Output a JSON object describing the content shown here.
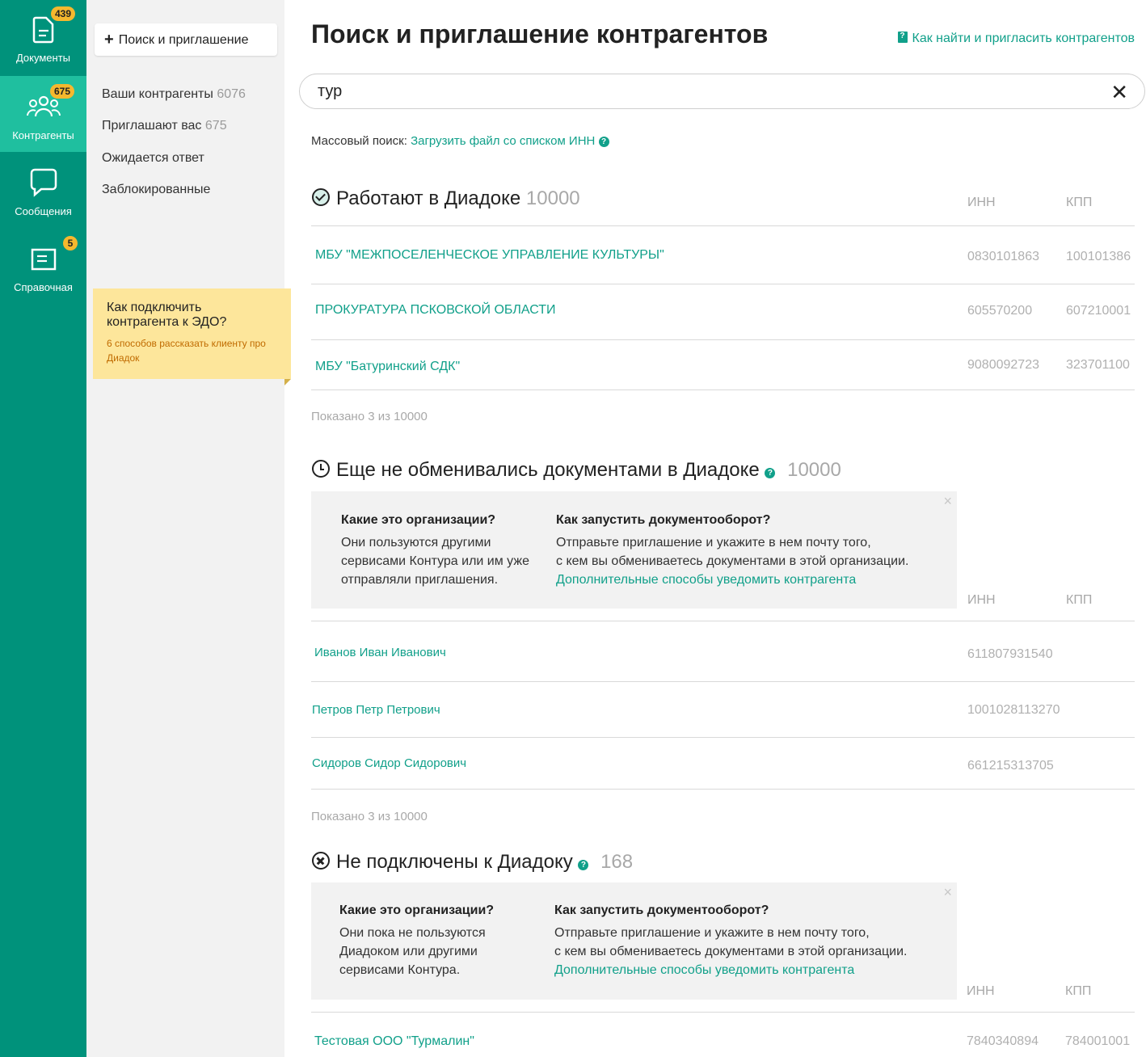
{
  "rail": {
    "documents": {
      "label": "Документы",
      "badge": "439"
    },
    "counterparties": {
      "label": "Контрагенты",
      "badge": "675"
    },
    "messages": {
      "label": "Сообщения"
    },
    "reference": {
      "label": "Справочная",
      "badge": "5"
    }
  },
  "sidebar": {
    "new_button": "Поиск и приглашение",
    "items": [
      {
        "label": "Ваши контрагенты",
        "count": "6076"
      },
      {
        "label": "Приглашают вас",
        "count": "675"
      },
      {
        "label": "Ожидается ответ",
        "count": ""
      },
      {
        "label": "Заблокированные",
        "count": ""
      }
    ],
    "tip": {
      "title": "Как подключить контрагента к ЭДО?",
      "subtitle": "6 способов рассказать клиенту про Диадок"
    }
  },
  "header": {
    "title": "Поиск и приглашение контрагентов",
    "help_link": "Как найти и пригласить контрагентов"
  },
  "search": {
    "value": "тур",
    "clear": "✕"
  },
  "mass_search": {
    "label": "Массовый поиск:",
    "link": "Загрузить файл со списком ИНН"
  },
  "columns": {
    "inn": "ИНН",
    "kpp": "КПП"
  },
  "sections": {
    "working": {
      "title": "Работают в Диадоке",
      "count": "10000",
      "rows": [
        {
          "name": "МБУ \"МЕЖПОСЕЛЕНЧЕСКОЕ УПРАВЛЕНИЕ КУЛЬТУРЫ\"",
          "inn": "0830101863",
          "kpp": "100101386"
        },
        {
          "name": "ПРОКУРАТУРА ПСКОВСКОЙ ОБЛАСТИ",
          "inn": "605570200",
          "kpp": "607210001"
        },
        {
          "name": "МБУ \"Батуринский СДК\"",
          "inn": "9080092723",
          "kpp": "323701100"
        }
      ],
      "shown": "Показано 3 из 10000"
    },
    "not_exchanged": {
      "title": "Еще не обменивались документами в Диадоке",
      "count": "10000",
      "info": {
        "q1": "Какие это организации?",
        "a1": "Они пользуются другими сервисами Контура или им уже отправляли приглашения.",
        "q2": "Как запустить документооборот?",
        "a2_line1": "Отправьте приглашение и укажите в нем почту того,",
        "a2_line2": "с кем вы обмениваетесь документами в этой организации.",
        "a2_link": "Дополнительные способы уведомить контрагента"
      },
      "rows": [
        {
          "name": "Иванов Иван Иванович",
          "inn": "611807931540"
        },
        {
          "name": "Петров Петр Петрович",
          "inn": "1001028113270"
        },
        {
          "name": "Сидоров Сидор Сидорович",
          "inn": "661215313705"
        }
      ],
      "shown": "Показано 3 из 10000"
    },
    "not_connected": {
      "title": "Не подключены к Диадоку",
      "count": "168",
      "info": {
        "q1": "Какие это организации?",
        "a1": "Они пока не пользуются Диадоком или другими сервисами Контура.",
        "q2": "Как запустить документооборот?",
        "a2_line1": "Отправьте приглашение и укажите в нем почту того,",
        "a2_line2": "с кем вы обмениваетесь документами в этой организации.",
        "a2_link": "Дополнительные способы уведомить контрагента"
      },
      "rows": [
        {
          "name": "Тестовая ООО \"Турмалин\"",
          "inn": "7840340894",
          "kpp": "784001001"
        }
      ]
    }
  }
}
